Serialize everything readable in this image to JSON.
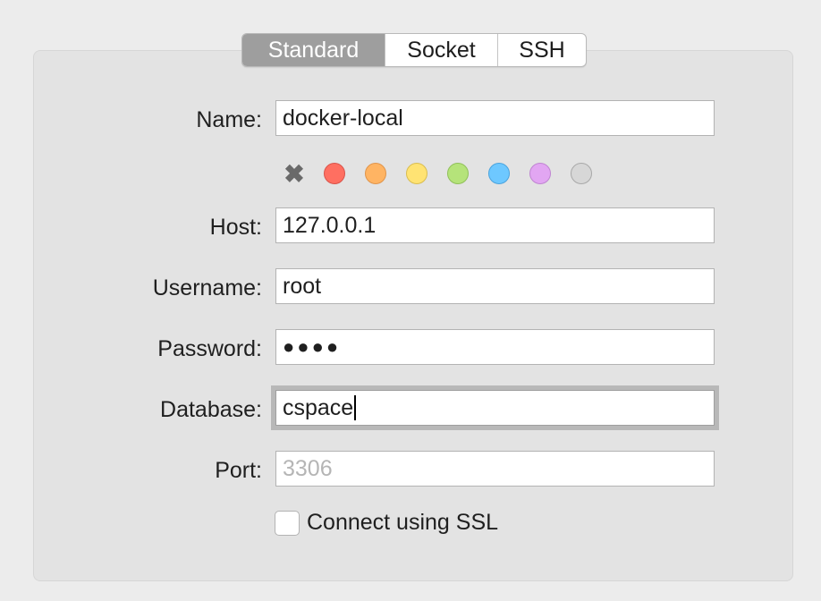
{
  "tabs": [
    {
      "label": "Standard",
      "active": true
    },
    {
      "label": "Socket",
      "active": false
    },
    {
      "label": "SSH",
      "active": false
    }
  ],
  "form": {
    "name": {
      "label": "Name:",
      "value": "docker-local"
    },
    "host": {
      "label": "Host:",
      "value": "127.0.0.1"
    },
    "username": {
      "label": "Username:",
      "value": "root"
    },
    "password": {
      "label": "Password:",
      "value": "●●●●"
    },
    "database": {
      "label": "Database:",
      "value": "cspace"
    },
    "port": {
      "label": "Port:",
      "value": "",
      "placeholder": "3306"
    }
  },
  "color_picker": {
    "clear_symbol": "✖",
    "colors": [
      {
        "name": "red",
        "fill": "#ff6f61",
        "border": "#d9534a"
      },
      {
        "name": "orange",
        "fill": "#ffb463",
        "border": "#e0944a"
      },
      {
        "name": "yellow",
        "fill": "#ffe373",
        "border": "#d9bd4f"
      },
      {
        "name": "green",
        "fill": "#b5e37a",
        "border": "#90c05a"
      },
      {
        "name": "blue",
        "fill": "#6ec8ff",
        "border": "#4aa3dd"
      },
      {
        "name": "purple",
        "fill": "#e2a6f2",
        "border": "#bf84d1"
      },
      {
        "name": "gray",
        "fill": "#d7d7d7",
        "border": "#a8a8a8"
      }
    ]
  },
  "ssl": {
    "label": "Connect using SSL",
    "checked": false
  }
}
